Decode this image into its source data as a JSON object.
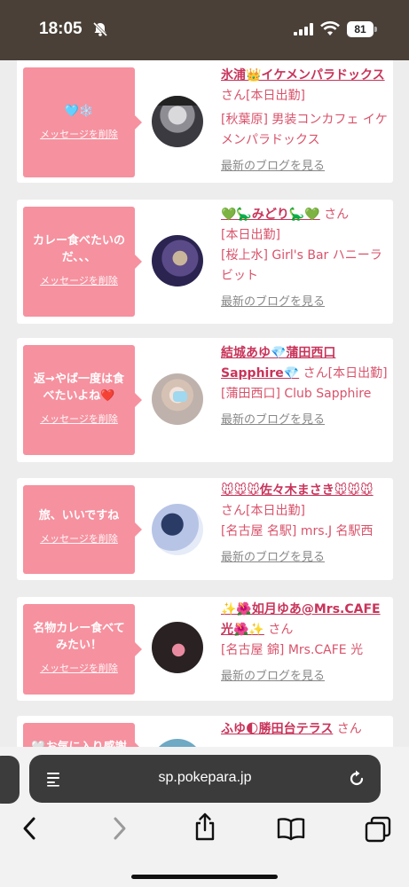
{
  "status_bar": {
    "time": "18:05",
    "battery": "81"
  },
  "cards": [
    {
      "bubble_message": "🩵❄️",
      "delete_label": "メッセージを削除",
      "cast_name": "氷浦👑イケメンパラドックス",
      "honorific": "さん",
      "status": "[本日出勤]",
      "shop": "[秋葉原] 男装コンカフェ イケメンパラドックス",
      "blog_link": "最新のブログを見る"
    },
    {
      "bubble_message": "カレー食べたいのだ、、、",
      "delete_label": "メッセージを削除",
      "cast_name": "💚🦕みどり🦕💚",
      "honorific": "さん",
      "status": "[本日出勤]",
      "shop": "[桜上水] Girl's Bar ハニーラビット",
      "blog_link": "最新のブログを見る"
    },
    {
      "bubble_message": "返→やば一度は食べたいよね❤️",
      "delete_label": "メッセージを削除",
      "cast_name": "結城あゆ💎蒲田西口Sapphire💎",
      "honorific": "さん",
      "status": "[本日出勤]",
      "shop": "[蒲田西口] Club Sapphire",
      "blog_link": "最新のブログを見る"
    },
    {
      "bubble_message": "旅、いいですね",
      "delete_label": "メッセージを削除",
      "cast_name": "🐭🐭🐭佐々木まさき🐭🐭🐭",
      "honorific": "さん",
      "status": "[本日出勤]",
      "shop": "[名古屋 名駅] mrs.J 名駅西",
      "blog_link": "最新のブログを見る"
    },
    {
      "bubble_message": "名物カレー食べてみたい！",
      "delete_label": "メッセージを削除",
      "cast_name": "✨🌺如月ゆあ@Mrs.CAFE光🌺✨",
      "honorific": "さん",
      "status": "",
      "shop": "[名古屋 錦] Mrs.CAFE 光",
      "blog_link": "最新のブログを見る"
    },
    {
      "bubble_message": "🤍お気に入り感謝",
      "delete_label": "メッセージを削除",
      "cast_name": "ふゆ🌓勝田台テラス",
      "honorific": "さん",
      "status": "",
      "shop": "",
      "blog_link": ""
    }
  ],
  "browser": {
    "url": "sp.pokepara.jp"
  }
}
